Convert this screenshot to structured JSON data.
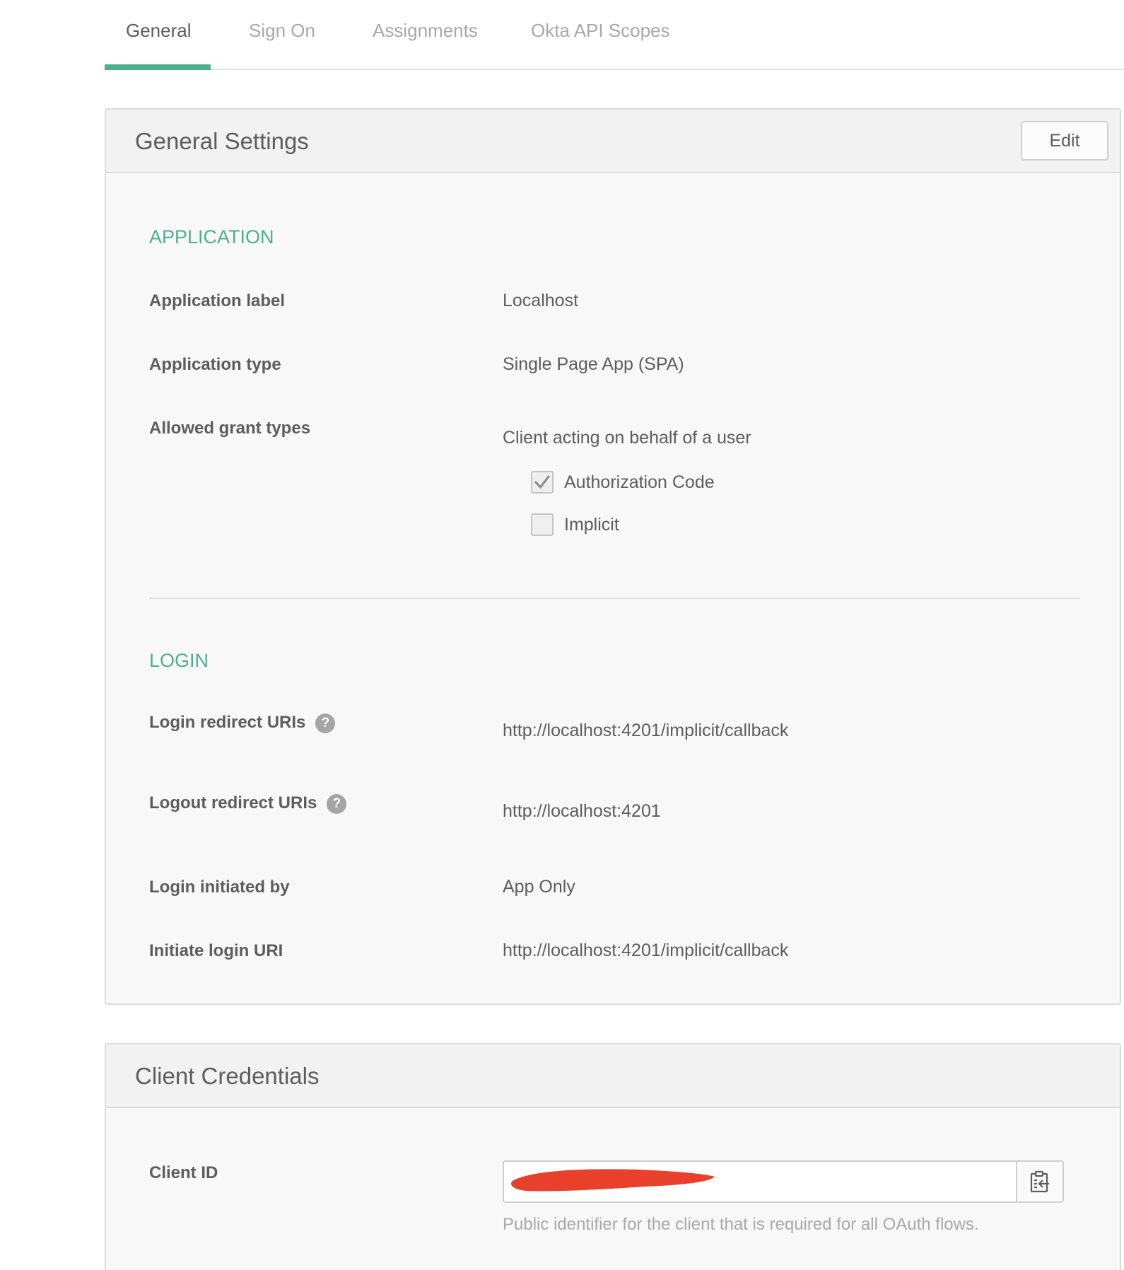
{
  "tabs": [
    {
      "label": "General",
      "active": true
    },
    {
      "label": "Sign On",
      "active": false
    },
    {
      "label": "Assignments",
      "active": false
    },
    {
      "label": "Okta API Scopes",
      "active": false
    }
  ],
  "general_settings": {
    "title": "General Settings",
    "edit_label": "Edit",
    "application": {
      "section_title": "APPLICATION",
      "label_title": "Application label",
      "label_value": "Localhost",
      "type_title": "Application type",
      "type_value": "Single Page App (SPA)",
      "grant_title": "Allowed grant types",
      "grant_subtitle": "Client acting on behalf of a user",
      "grants": [
        {
          "label": "Authorization Code",
          "checked": true
        },
        {
          "label": "Implicit",
          "checked": false
        }
      ]
    },
    "login": {
      "section_title": "LOGIN",
      "redirect_title": "Login redirect URIs",
      "redirect_value": "http://localhost:4201/implicit/callback",
      "logout_title": "Logout redirect URIs",
      "logout_value": "http://localhost:4201",
      "initiated_title": "Login initiated by",
      "initiated_value": "App Only",
      "initiate_uri_title": "Initiate login URI",
      "initiate_uri_value": "http://localhost:4201/implicit/callback",
      "help_glyph": "?"
    }
  },
  "client_credentials": {
    "title": "Client Credentials",
    "client_id_title": "Client ID",
    "client_id_hint": "Public identifier for the client that is required for all OAuth flows.",
    "copy_icon": "clipboard-copy-icon",
    "redaction_color": "#e8402a"
  },
  "colors": {
    "accent": "#4cb08f",
    "text": "#5d5d5d",
    "muted": "#a8a8a8"
  }
}
